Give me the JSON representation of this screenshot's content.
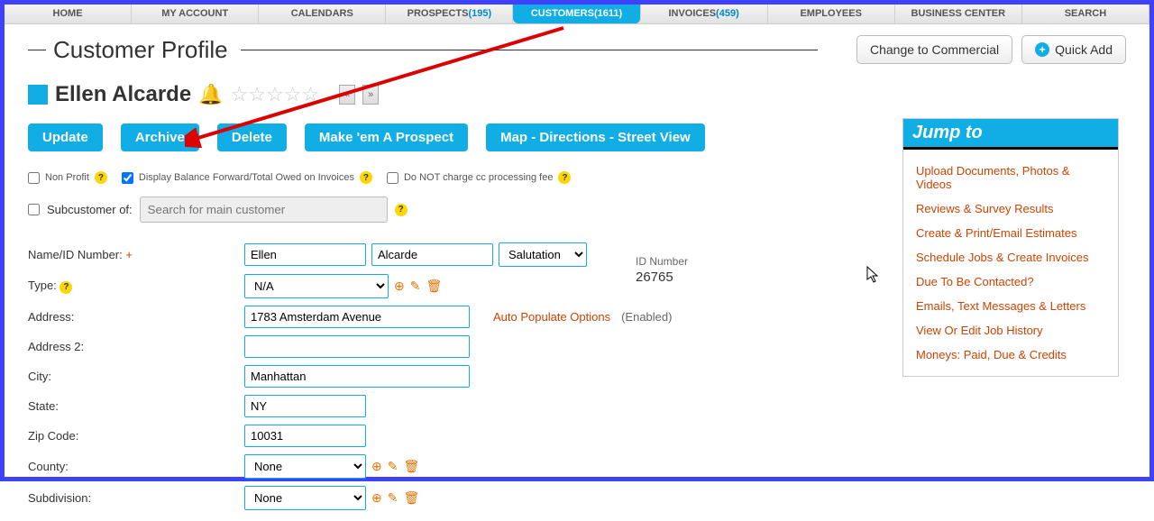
{
  "nav": {
    "home": "HOME",
    "myaccount": "MY ACCOUNT",
    "calendars": "CALENDARS",
    "prospects": "PROSPECTS",
    "prospects_count": "(195)",
    "customers": "CUSTOMERS",
    "customers_count": "(1611)",
    "invoices": "INVOICES",
    "invoices_count": "(459)",
    "employees": "EMPLOYEES",
    "biz": "BUSINESS CENTER",
    "search": "SEARCH"
  },
  "page": {
    "title": "Customer Profile",
    "change_commercial": "Change to Commercial",
    "quick_add": "Quick Add"
  },
  "customer": {
    "name": "Ellen Alcarde",
    "stars": "☆☆☆☆☆"
  },
  "actions": {
    "update": "Update",
    "archive": "Archive",
    "delete": "Delete",
    "make_prospect": "Make 'em A Prospect",
    "map": "Map - Directions - Street View"
  },
  "opts": {
    "nonprofit": "Non Profit",
    "display_balance": "Display Balance Forward/Total Owed on Invoices",
    "nocc": "Do NOT charge cc processing fee"
  },
  "subcust": {
    "label": "Subcustomer of:",
    "placeholder": "Search for main customer"
  },
  "labels": {
    "name_id": "Name/ID Number:",
    "type": "Type:",
    "address": "Address:",
    "address2": "Address 2:",
    "city": "City:",
    "state": "State:",
    "zip": "Zip Code:",
    "county": "County:",
    "subdivision": "Subdivision:"
  },
  "form": {
    "first": "Ellen",
    "last": "Alcarde",
    "salutation": "Salutation",
    "type": "N/A",
    "address": "1783 Amsterdam Avenue",
    "address2": "",
    "city": "Manhattan",
    "state": "NY",
    "zip": "10031",
    "county": "None",
    "subdivision": "None",
    "auto_populate": "Auto Populate Options",
    "enabled": "(Enabled)",
    "id_label": "ID Number",
    "id_value": "26765"
  },
  "jump": {
    "title": "Jump to",
    "items": [
      "Upload Documents, Photos & Videos",
      "Reviews & Survey Results",
      "Create & Print/Email Estimates",
      "Schedule Jobs & Create Invoices",
      "Due To Be Contacted?",
      "Emails, Text Messages & Letters",
      "View Or Edit Job History",
      "Moneys: Paid, Due & Credits"
    ]
  }
}
